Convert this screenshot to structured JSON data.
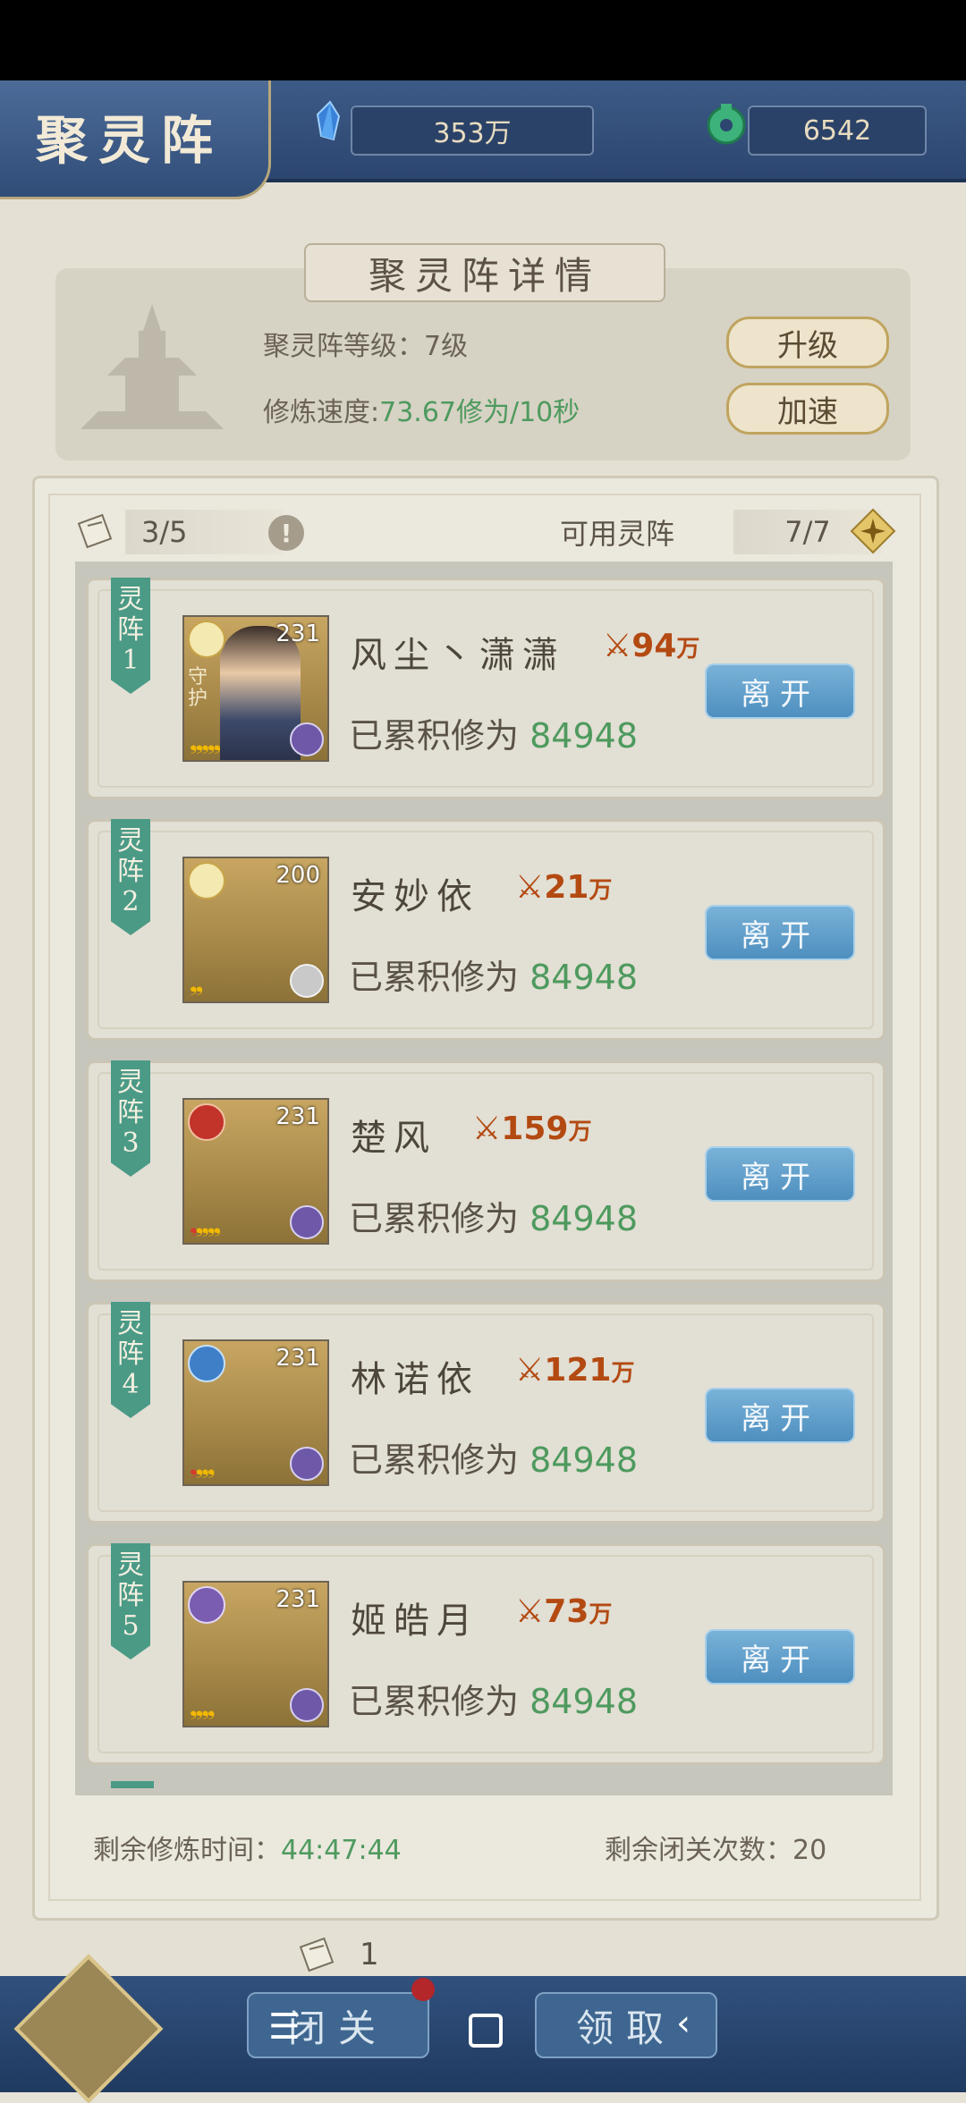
{
  "header": {
    "title": "聚灵阵",
    "resources": [
      {
        "icon": "crystal-icon",
        "value": "353万"
      },
      {
        "icon": "jade-coin-icon",
        "value": "6542"
      }
    ]
  },
  "detail": {
    "title": "聚灵阵详情",
    "level_label": "聚灵阵等级：7级",
    "speed_label": "修炼速度:",
    "speed_value": "73.67修为/10秒",
    "upgrade_label": "升级",
    "speedup_label": "加速"
  },
  "summary": {
    "occupied": "3/5",
    "available_label": "可用灵阵",
    "available_count": "7/7"
  },
  "slots": [
    {
      "ribbon": "灵阵1",
      "level": "231",
      "name": "风尘丶潇潇",
      "power": "94",
      "power_unit": "万",
      "accum_label": "已累积修为",
      "accum_value": "84948",
      "guard": "守护",
      "leave_label": "离开"
    },
    {
      "ribbon": "灵阵2",
      "level": "200",
      "name": "安妙依",
      "power": "21",
      "power_unit": "万",
      "accum_label": "已累积修为",
      "accum_value": "84948",
      "leave_label": "离开"
    },
    {
      "ribbon": "灵阵3",
      "level": "231",
      "name": "楚风",
      "power": "159",
      "power_unit": "万",
      "accum_label": "已累积修为",
      "accum_value": "84948",
      "leave_label": "离开"
    },
    {
      "ribbon": "灵阵4",
      "level": "231",
      "name": "林诺依",
      "power": "121",
      "power_unit": "万",
      "accum_label": "已累积修为",
      "accum_value": "84948",
      "leave_label": "离开"
    },
    {
      "ribbon": "灵阵5",
      "level": "231",
      "name": "姬皓月",
      "power": "73",
      "power_unit": "万",
      "accum_label": "已累积修为",
      "accum_value": "84948",
      "leave_label": "离开"
    }
  ],
  "footer": {
    "time_label": "剩余修炼时间：",
    "time_value": "44:47:44",
    "closures_label": "剩余闭关次数：20"
  },
  "bottom": {
    "scroll_count": "1",
    "seclusion_label": "闭关",
    "claim_label": "领取"
  },
  "colors": {
    "accent_green": "#4e9a5e",
    "power_red": "#b34a12",
    "leave_blue": "#4e8fbf"
  }
}
